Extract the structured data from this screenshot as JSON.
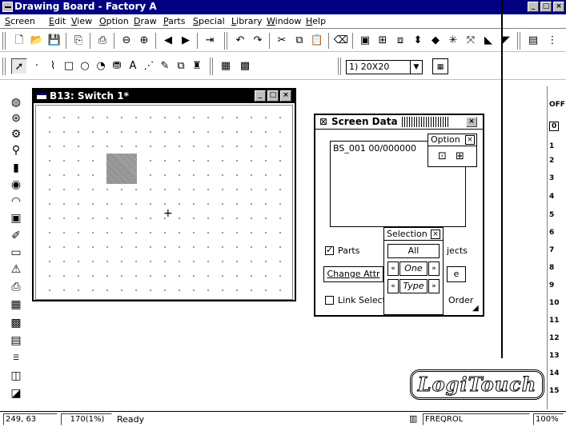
{
  "window": {
    "title": "Drawing Board - Factory A"
  },
  "menu": [
    "Screen",
    "Edit",
    "View",
    "Option",
    "Draw",
    "Parts",
    "Special",
    "Library",
    "Window",
    "Help"
  ],
  "toolbar1": {
    "icons": [
      "new-icon",
      "open-icon",
      "save-icon",
      "screen-icon",
      "print-icon",
      "zoom-out-icon",
      "zoom-in-icon",
      "prev-icon",
      "next-icon",
      "jump-icon",
      "undo-icon",
      "redo-icon",
      "cut-icon",
      "copy-icon",
      "paste-icon",
      "delete-icon",
      "group-icon",
      "ungroup-icon",
      "move-front-icon",
      "move-back-icon",
      "align-icon",
      "flip-icon",
      "rotate-icon"
    ]
  },
  "toolbar2": {
    "grid_select": "1) 20X20",
    "icons": [
      "select-icon",
      "dot-icon",
      "polyline-icon",
      "rectangle-icon",
      "circle-icon",
      "arc-icon",
      "fill-icon",
      "text-icon",
      "paint-icon",
      "pen-icon",
      "shape-icon",
      "stamp-icon",
      "library-icon",
      "library2-icon"
    ]
  },
  "palette": {
    "icons": [
      "lamp-icon",
      "switch-icon",
      "gear-icon",
      "alarm-icon",
      "bar-graph-icon",
      "circle-graph-icon",
      "meter-icon",
      "trend-icon",
      "keypad-icon",
      "display-icon",
      "alarm2-icon",
      "printer-icon",
      "table-icon",
      "numeric-icon",
      "text-display-icon",
      "date-icon",
      "monitor-icon",
      "tag-icon"
    ]
  },
  "child": {
    "title": "B13: Switch 1*"
  },
  "screen_data": {
    "title": "Screen Data",
    "list_item": "BS_001  00/000000",
    "parts_label": "Parts",
    "parts_checked": true,
    "objects_label": "jects",
    "change_attr_label": "Change Attr",
    "change_attr_suffix": "e",
    "link_select_label": "Link Select",
    "link_select_checked": false,
    "order_label": "Order"
  },
  "option_popup": {
    "title": "Option"
  },
  "selection_popup": {
    "title": "Selection",
    "all_label": "All",
    "one_label": "One",
    "type_label": "Type"
  },
  "right_panel": {
    "header": "OFF",
    "items": [
      "0",
      "1",
      "2",
      "3",
      "4",
      "5",
      "6",
      "7",
      "8",
      "9",
      "10",
      "11",
      "12",
      "13",
      "14",
      "15"
    ]
  },
  "logo": "LogiTouch",
  "status": {
    "coords": "249, 63",
    "zoom": "170(1%)",
    "state": "Ready",
    "freq": "FREQROL",
    "percent": "100%"
  }
}
